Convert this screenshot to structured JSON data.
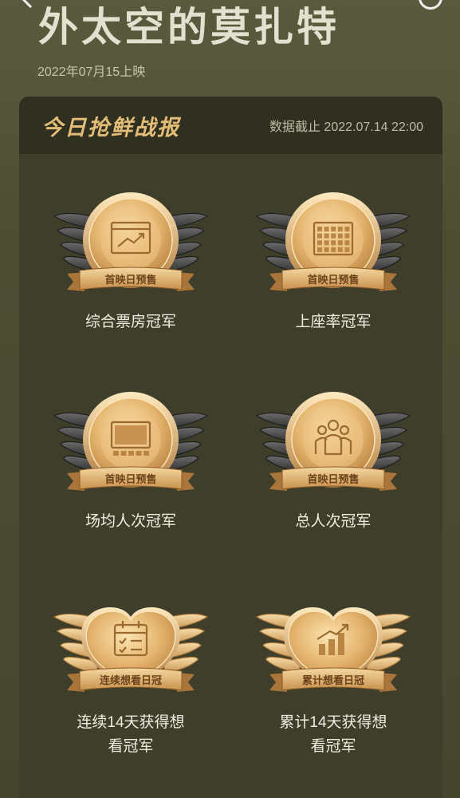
{
  "movie": {
    "title": "外太空的莫扎特",
    "release_date": "2022年07月15上映"
  },
  "report": {
    "title": "今日抢鲜战报",
    "data_cutoff": "数据截止 2022.07.14 22:00"
  },
  "badges": [
    {
      "icon": "chart-icon",
      "ribbon": "首映日预售",
      "label": "综合票房冠军",
      "style": "winged-dark"
    },
    {
      "icon": "seats-icon",
      "ribbon": "首映日预售",
      "label": "上座率冠军",
      "style": "winged-dark"
    },
    {
      "icon": "screen-icon",
      "ribbon": "首映日预售",
      "label": "场均人次冠军",
      "style": "winged-dark"
    },
    {
      "icon": "people-icon",
      "ribbon": "首映日预售",
      "label": "总人次冠军",
      "style": "winged-dark"
    },
    {
      "icon": "calendar-check-icon",
      "ribbon": "连续想看日冠",
      "label": "连续14天获得想\n看冠军",
      "style": "heart-gold"
    },
    {
      "icon": "bar-growth-icon",
      "ribbon": "累计想看日冠",
      "label": "累计14天获得想\n看冠军",
      "style": "heart-gold"
    }
  ],
  "colors": {
    "gold_accent": "#e3bd78",
    "card_bg": "#3e3e2b",
    "header_bg": "#303021"
  }
}
